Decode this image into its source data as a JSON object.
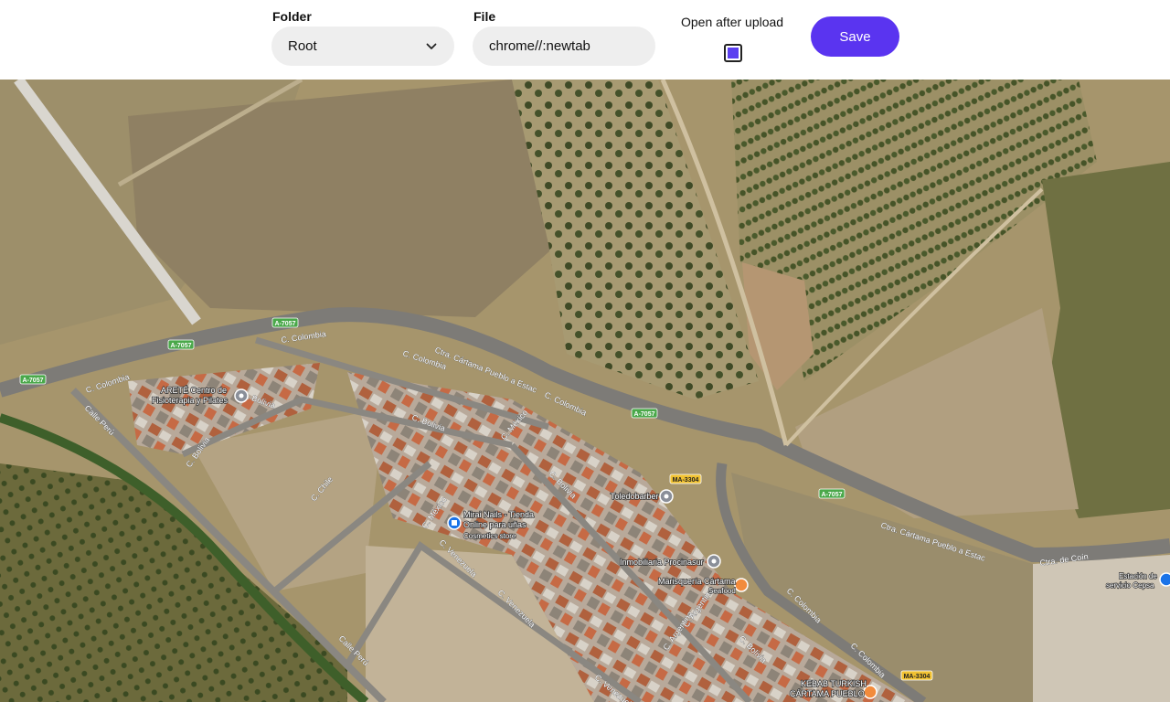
{
  "toolbar": {
    "folder_label": "Folder",
    "folder_value": "Root",
    "file_label": "File",
    "file_value": "chrome//:newtab",
    "open_after_upload_label": "Open after upload",
    "open_after_upload_checked": true,
    "save_label": "Save",
    "accent_color": "#5a34f0"
  },
  "map": {
    "road_labels": [
      "C. Colombia",
      "Ctra. Cártama Pueblo a Estac",
      "C. Colombia",
      "C. Colombia",
      "C. Bolivia",
      "C. Bolivia",
      "C. México",
      "C. Bolivia",
      "Calle Perú",
      "C. Chile",
      "C. México",
      "C. Venezuela",
      "C. Venezuela",
      "C. Argentina",
      "C. Colombia",
      "C. Colombia",
      "Ctra. Cártama Pueblo a Estac",
      "Ctra. de Coín",
      "Calle Perú",
      "C. Colombia",
      "C. Bolivia",
      "C. Bolivia",
      "C. Venezuela",
      "C. Argentina"
    ],
    "route_shields": [
      "A-7057",
      "A-7057",
      "A-7057",
      "A-7057",
      "A-7057",
      "MA-3304",
      "MA-3304"
    ],
    "pois": [
      {
        "name": "ARETÉ Centro de Fisioterapia y Pilates",
        "icon": "pin-icon"
      },
      {
        "name": "Mirai Nails - Tienda Online para uñas",
        "sub": "Cosmetics store",
        "icon": "shopping-bag-icon"
      },
      {
        "name": "Toledobarber",
        "icon": "pin-icon"
      },
      {
        "name": "Inmobiliaria Procinasur",
        "icon": "pin-icon"
      },
      {
        "name": "Marisquería Cártama",
        "sub": "Seafood",
        "icon": "restaurant-icon"
      },
      {
        "name": "KEBAB TURKISH CÁRTAMA PUEBLO",
        "icon": "restaurant-icon"
      },
      {
        "name": "Estación de servicio Cepsa",
        "icon": "gas-station-icon"
      }
    ]
  }
}
